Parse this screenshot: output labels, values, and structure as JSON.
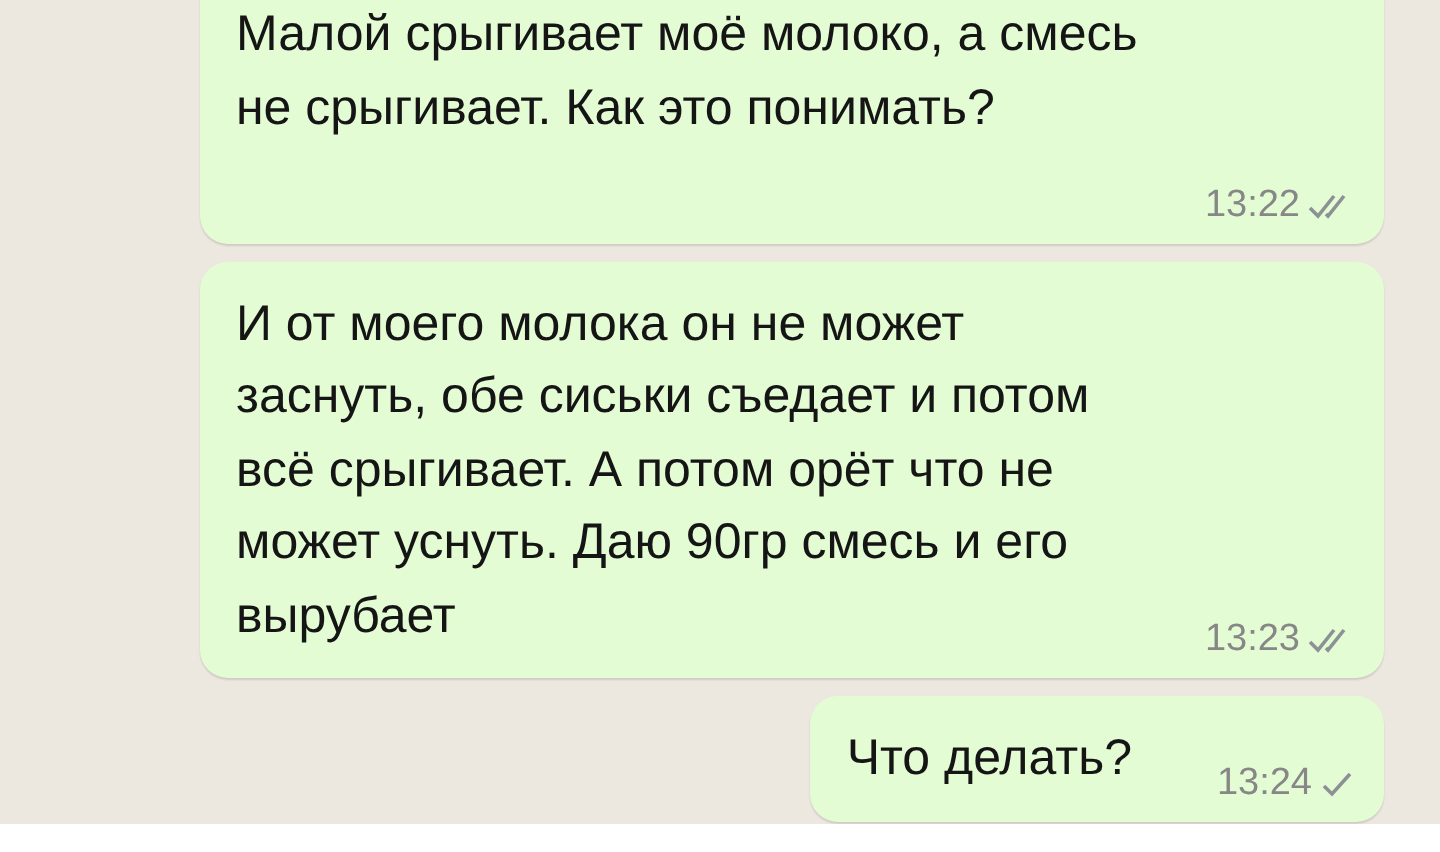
{
  "messages": [
    {
      "text": "Малой срыгивает моё молоко, а смесь не срыгивает. Как это понимать?",
      "time": "13:22",
      "double_tick": true
    },
    {
      "text": "И от моего молока он не может заснуть, обе сиськи съедает и потом всё срыгивает. А потом орёт что не может уснуть. Даю 90гр смесь и его вырубает",
      "time": "13:23",
      "double_tick": true
    },
    {
      "text": "Что делать?",
      "time": "13:24",
      "double_tick": false
    }
  ]
}
